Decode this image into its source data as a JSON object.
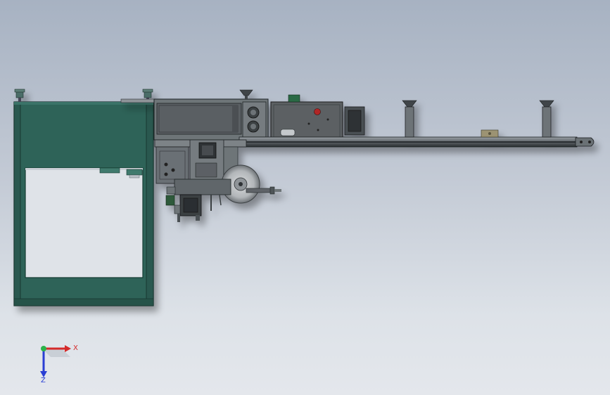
{
  "app": {
    "window_title": "",
    "view": "top-view"
  },
  "colors": {
    "frame_green": "#2e6459",
    "frame_green_dark": "#1d4a41",
    "metal_gray": "#6e7478",
    "plate_gray": "#55595c",
    "dark_edge": "#1f2325",
    "rail_gray": "#8b9196",
    "axis_x": "#d42a2a",
    "axis_y": "#2bb34a",
    "axis_z": "#2a3fd4"
  },
  "triad": {
    "x_label": "X",
    "z_label": "Z",
    "icons": [
      "x-axis-arrow-icon",
      "y-axis-dot-icon",
      "z-axis-arrow-icon"
    ]
  }
}
